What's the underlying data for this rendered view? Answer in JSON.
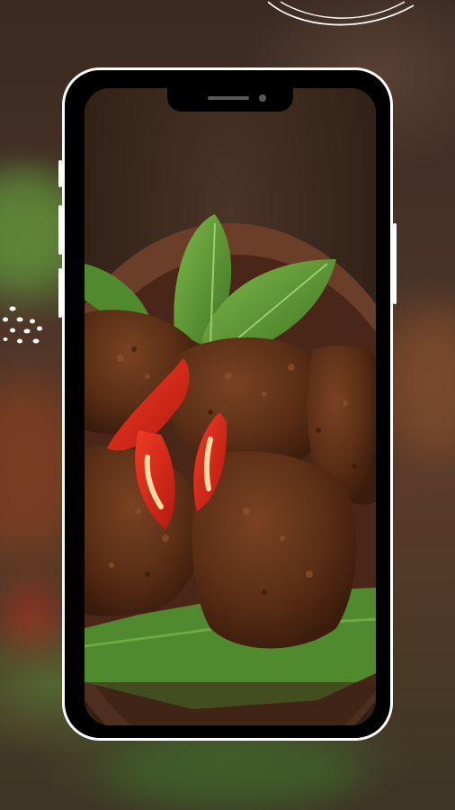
{
  "screen": {
    "image_icon": "food-photo-rendang-icon",
    "subject": "rendang"
  },
  "decorations": {
    "dots_icon": "scatter-dots-icon",
    "wave_icon": "curved-lines-icon"
  },
  "colors": {
    "phone_frame": "#000000",
    "phone_border": "#ffffff",
    "beef": "#5a2e16",
    "leaf": "#4f8a2e",
    "chili": "#d8261a",
    "plate": "#6b3e2a"
  }
}
